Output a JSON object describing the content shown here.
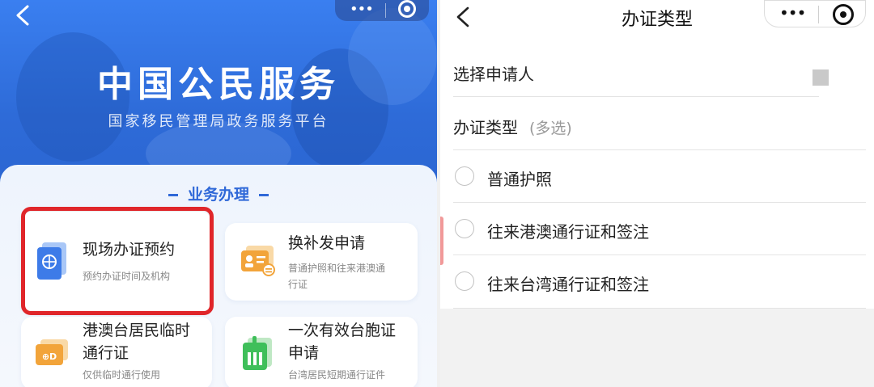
{
  "left": {
    "hero": {
      "title": "中国公民服务",
      "subtitle": "国家移民管理局政务服务平台"
    },
    "section_title": "业务办理",
    "services": [
      {
        "name": "现场办证预约",
        "desc": "预约办证时间及机构",
        "icon": "passport-globe-icon",
        "highlighted": true
      },
      {
        "name": "换补发申请",
        "desc_line1": "普通护照和往来港澳通",
        "desc_line2": "行证",
        "icon": "id-card-icon"
      },
      {
        "name_line1": "港澳台居民临时",
        "name_line2": "通行证",
        "desc": "仅供临时通行使用",
        "icon": "temporary-pass-icon"
      },
      {
        "name_line1": "一次有效台胞证",
        "name_line2": "申请",
        "desc": "台湾居民短期通行证件",
        "icon": "single-entry-permit-icon"
      }
    ],
    "colors": {
      "accent": "#2f68d8",
      "highlight": "#e0262a"
    }
  },
  "right": {
    "nav": {
      "title": "办证类型"
    },
    "select_applicant": "选择申请人",
    "cert_type": {
      "label": "办证类型",
      "hint": "(多选)"
    },
    "options": [
      "普通护照",
      "往来港澳通行证和签注",
      "往来台湾通行证和签注"
    ]
  }
}
